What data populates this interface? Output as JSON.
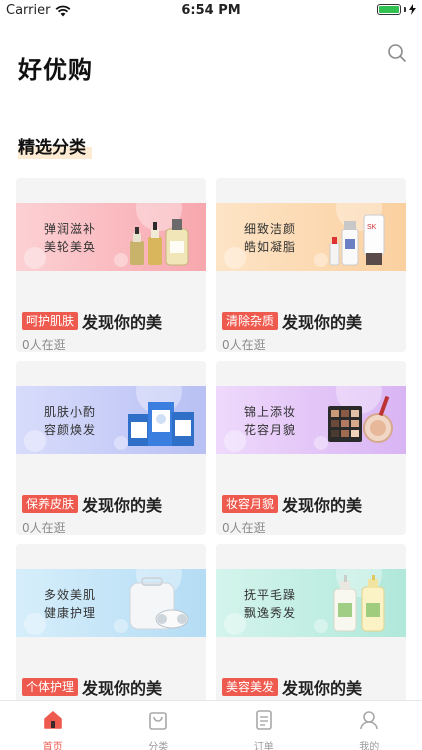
{
  "status_bar": {
    "carrier": "Carrier",
    "time": "6:54 PM"
  },
  "header": {
    "title": "好优购"
  },
  "section": {
    "title": "精选分类"
  },
  "colors": {
    "accent": "#ef5a4f"
  },
  "cards": [
    {
      "tag": "呵护肌肤",
      "title": "发现你的美",
      "visitors": "0人在逛",
      "line1": "弹润滋补",
      "line2": "美轮美奂",
      "bg": "#fcd1d4",
      "bg2": "#f7a7ae",
      "product": "serum-bottles-icon"
    },
    {
      "tag": "清除杂质",
      "title": "发现你的美",
      "visitors": "0人在逛",
      "line1": "细致洁颜",
      "line2": "皓如凝脂",
      "bg": "#fde4c6",
      "bg2": "#fbd0a0",
      "product": "cleanser-bottles-icon"
    },
    {
      "tag": "保养皮肤",
      "title": "发现你的美",
      "visitors": "0人在逛",
      "line1": "肌肤小酌",
      "line2": "容颜焕发",
      "bg": "#d8dcfb",
      "bg2": "#b8c0f4",
      "product": "face-mask-boxes-icon"
    },
    {
      "tag": "妆容月貌",
      "title": "发现你的美",
      "visitors": "0人在逛",
      "line1": "锦上添妆",
      "line2": "花容月貌",
      "bg": "#eed9fb",
      "bg2": "#d9b4f4",
      "product": "makeup-palette-icon"
    },
    {
      "tag": "个体护理",
      "title": "发现你的美",
      "visitors": "",
      "line1": "多效美肌",
      "line2": "健康护理",
      "bg": "#d6eefb",
      "bg2": "#b4dcf4",
      "product": "beauty-device-icon"
    },
    {
      "tag": "美容美发",
      "title": "发现你的美",
      "visitors": "",
      "line1": "抚平毛躁",
      "line2": "飘逸秀发",
      "bg": "#d4f4ec",
      "bg2": "#b0e8da",
      "product": "shampoo-bottles-icon"
    }
  ],
  "tabbar": [
    {
      "label": "首页",
      "icon": "home-icon",
      "active": true
    },
    {
      "label": "分类",
      "icon": "bag-icon",
      "active": false
    },
    {
      "label": "订单",
      "icon": "order-list-icon",
      "active": false
    },
    {
      "label": "我的",
      "icon": "user-icon",
      "active": false
    }
  ]
}
